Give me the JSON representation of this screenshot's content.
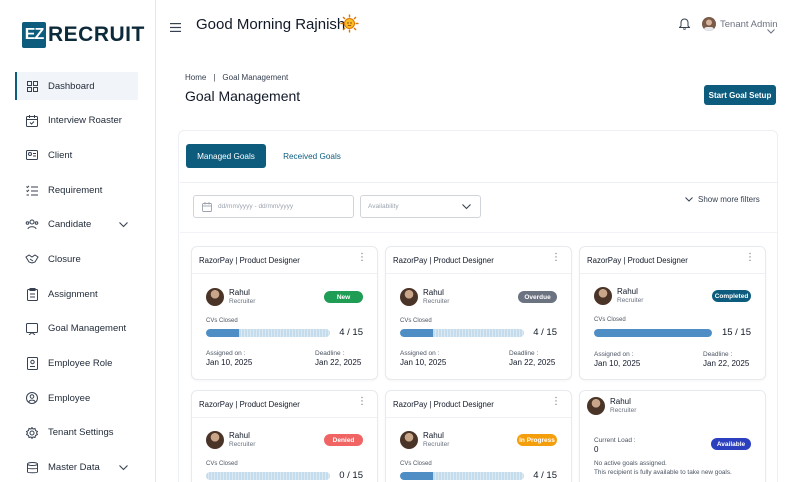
{
  "brand": {
    "logo_mark": "EZ",
    "logo_text": "RECRUIT",
    "color": "#0d5c7e"
  },
  "sidebar": {
    "items": [
      {
        "label": "Dashboard",
        "icon": "grid-icon"
      },
      {
        "label": "Interview Roaster",
        "icon": "calendar-icon"
      },
      {
        "label": "Client",
        "icon": "id-card-icon"
      },
      {
        "label": "Requirement",
        "icon": "list-check-icon"
      },
      {
        "label": "Candidate",
        "icon": "users-icon"
      },
      {
        "label": "Closure",
        "icon": "handshake-icon"
      },
      {
        "label": "Assignment",
        "icon": "clipboard-icon"
      },
      {
        "label": "Goal Management",
        "icon": "flag-icon"
      },
      {
        "label": "Employee Role",
        "icon": "badge-icon"
      },
      {
        "label": "Employee",
        "icon": "user-circle-icon"
      },
      {
        "label": "Tenant Settings",
        "icon": "gear-icon"
      },
      {
        "label": "Master Data",
        "icon": "database-icon"
      }
    ],
    "active_index": 0
  },
  "header": {
    "greeting": "Good Morning Rajnish",
    "user_name": "Tenant Admin"
  },
  "breadcrumb": {
    "home": "Home",
    "separator": "|",
    "current": "Goal Management"
  },
  "page": {
    "title": "Goal Management",
    "start_button": "Start Goal Setup"
  },
  "tabs": [
    {
      "label": "Managed Goals",
      "active": true
    },
    {
      "label": "Received Goals",
      "active": false
    }
  ],
  "filters": {
    "date_placeholder": "dd/mm/yyyy - dd/mm/yyyy",
    "availability_placeholder": "Availability",
    "more_filters": "Show more filters"
  },
  "cards": [
    {
      "title": "RazorPay | Product Designer",
      "name": "Rahul",
      "role": "Recruiter",
      "status": "New",
      "status_color": "#1f9d55",
      "cvs_label": "CVs Closed",
      "progress": 0.27,
      "count": "4 / 15",
      "assigned_label": "Assigned on :",
      "assigned": "Jan 10, 2025",
      "deadline_label": "Deadline :",
      "deadline": "Jan 22, 2025"
    },
    {
      "title": "RazorPay | Product Designer",
      "name": "Rahul",
      "role": "Recruiter",
      "status": "Overdue",
      "status_color": "#6b7280",
      "cvs_label": "CVs Closed",
      "progress": 0.27,
      "count": "4 / 15",
      "assigned_label": "Assigned on :",
      "assigned": "Jan 10, 2025",
      "deadline_label": "Deadline :",
      "deadline": "Jan 22, 2025"
    },
    {
      "title": "RazorPay | Product Designer",
      "name": "Rahul",
      "role": "Recruiter",
      "status": "Completed",
      "status_color": "#0d5c7e",
      "cvs_label": "CVs Closed",
      "progress": 1.0,
      "count": "15 / 15",
      "assigned_label": "Assigned on :",
      "assigned": "Jan 10, 2025",
      "deadline_label": "Deadline :",
      "deadline": "Jan 22, 2025"
    },
    {
      "title": "RazorPay | Product Designer",
      "name": "Rahul",
      "role": "Recruiter",
      "status": "Denied",
      "status_color": "#f06464",
      "cvs_label": "CVs Closed",
      "progress": 0.0,
      "count": "0 / 15"
    },
    {
      "title": "RazorPay | Product Designer",
      "name": "Rahul",
      "role": "Recruiter",
      "status": "In Progress",
      "status_color": "#f59e0b",
      "cvs_label": "CVs Closed",
      "progress": 0.27,
      "count": "4 / 15"
    }
  ],
  "availability_card": {
    "name": "Rahul",
    "role": "Recruiter",
    "load_label": "Current Load :",
    "load_value": "0",
    "status": "Available",
    "status_color": "#2b3fbf",
    "note_line1": "No active goals assigned.",
    "note_line2": "This recipient is fully available to take new goals."
  }
}
